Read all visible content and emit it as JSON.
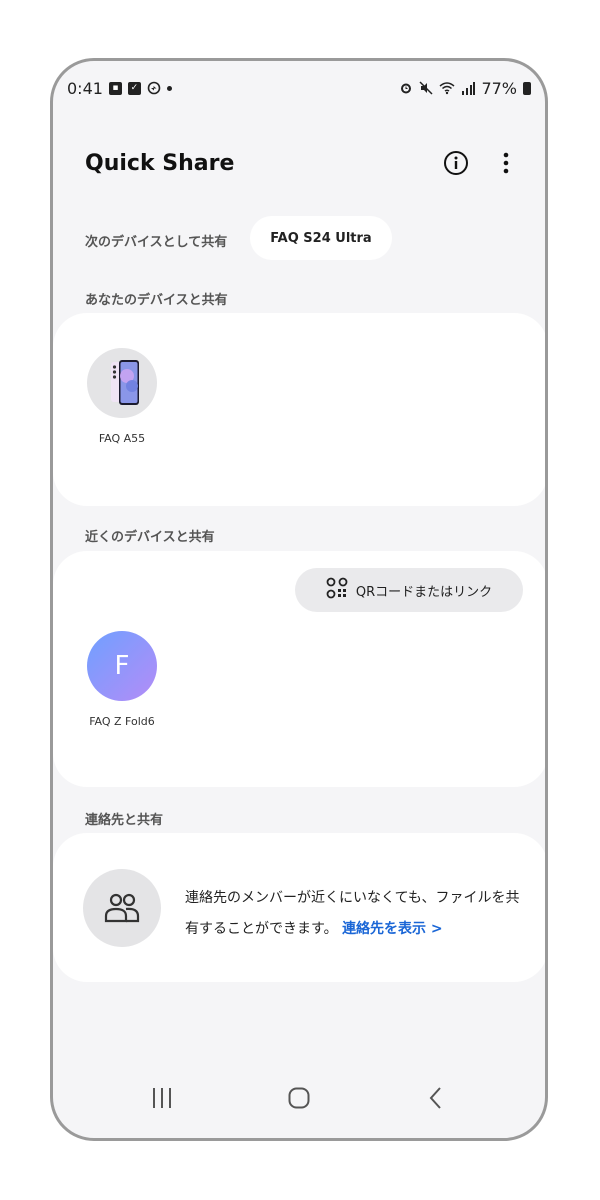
{
  "status_bar": {
    "time": "0:41",
    "battery": "77%",
    "left_icons": [
      "gallery-icon",
      "check-icon",
      "sync-icon",
      "dot-icon"
    ],
    "right_icons": [
      "alarm-icon",
      "mute-icon",
      "wifi-icon",
      "signal-icon",
      "battery-icon"
    ]
  },
  "header": {
    "title": "Quick Share",
    "info_icon": "info-icon",
    "more_icon": "more-vertical-icon"
  },
  "share_as": {
    "label": "次のデバイスとして共有",
    "device": "FAQ S24 Ultra"
  },
  "your_devices": {
    "label": "あなたのデバイスと共有",
    "devices": [
      {
        "name": "FAQ A55",
        "icon": "phone-thumbnail"
      }
    ]
  },
  "nearby": {
    "label": "近くのデバイスと共有",
    "qr_button": "QRコードまたはリンク",
    "devices": [
      {
        "name": "FAQ Z Fold6",
        "initial": "F"
      }
    ]
  },
  "contacts": {
    "label": "連絡先と共有",
    "description": "連絡先のメンバーが近くにいなくても、ファイルを共有することができます。",
    "link": "連絡先を表示 >"
  },
  "nav": {
    "recents": "recents-icon",
    "home": "home-icon",
    "back": "back-icon"
  },
  "colors": {
    "background": "#f5f5f7",
    "card": "#ffffff",
    "link": "#1a66d6",
    "avatar_gradient_start": "#6fa0ff",
    "avatar_gradient_end": "#b48cf7"
  }
}
